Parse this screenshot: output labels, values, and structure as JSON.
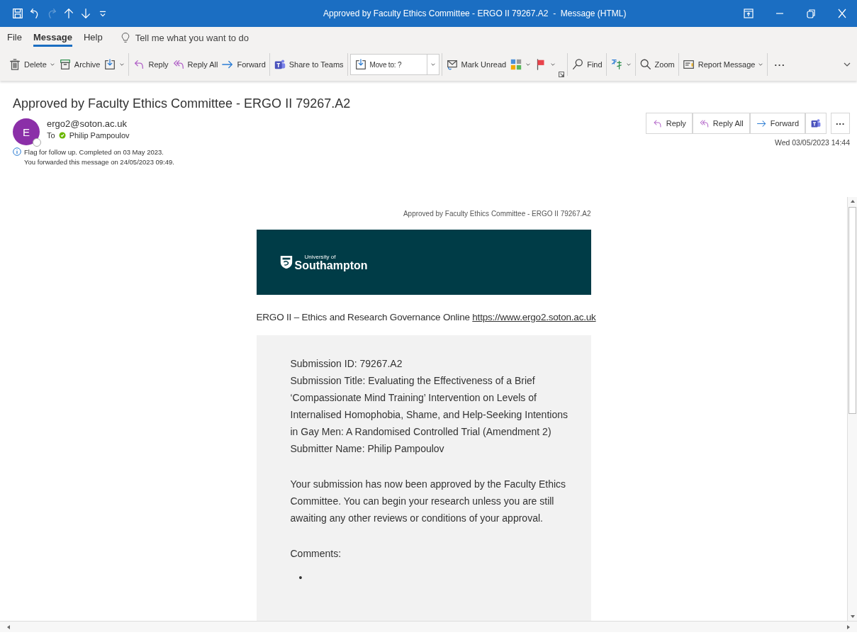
{
  "title_bar": {
    "quick_access": [
      {
        "disabled": false
      },
      {
        "disabled": false
      },
      {
        "disabled": true
      },
      {
        "disabled": false
      },
      {
        "disabled": false
      },
      {
        "disabled": false
      }
    ],
    "title": "Approved by Faculty Ethics Committee - ERGO II 79267.A2  -  Message (HTML)"
  },
  "ribbon_tabs": [
    {
      "label": "File",
      "selected": false
    },
    {
      "label": "Message",
      "selected": true
    },
    {
      "label": "Help",
      "selected": false
    }
  ],
  "tell_me": {
    "placeholder": "Tell me what you want to do"
  },
  "toolbar": [
    {
      "kind": "button",
      "label": "Delete",
      "dropdown": true
    },
    {
      "kind": "button",
      "label": "Archive",
      "dropdown": false
    },
    {
      "kind": "button",
      "dropdown": true
    },
    {
      "kind": "separator"
    },
    {
      "kind": "button",
      "label": "Reply",
      "dropdown": false
    },
    {
      "kind": "button",
      "label": "Reply All",
      "dropdown": false
    },
    {
      "kind": "button",
      "label": "Forward",
      "dropdown": false
    },
    {
      "kind": "separator"
    },
    {
      "kind": "button",
      "label": "Share to Teams",
      "dropdown": false
    },
    {
      "kind": "separator"
    },
    {
      "kind": "combo",
      "value": "Move to: ?"
    },
    {
      "kind": "separator"
    },
    {
      "kind": "button",
      "label": "Mark Unread",
      "dropdown": false
    },
    {
      "kind": "button",
      "dropdown": true
    },
    {
      "kind": "button",
      "dropdown": true
    },
    {
      "kind": "launcher"
    },
    {
      "kind": "separator"
    },
    {
      "kind": "button",
      "label": "Find",
      "dropdown": false
    },
    {
      "kind": "separator"
    },
    {
      "kind": "button",
      "dropdown": true
    },
    {
      "kind": "separator"
    },
    {
      "kind": "button",
      "label": "Zoom",
      "dropdown": false
    },
    {
      "kind": "separator"
    },
    {
      "kind": "button",
      "label": "Report Message",
      "dropdown": true
    },
    {
      "kind": "separator"
    },
    {
      "kind": "more",
      "label": "···"
    }
  ],
  "message": {
    "subject": "Approved by Faculty Ethics Committee - ERGO II 79267.A2",
    "avatar_initial": "E",
    "sender": "ergo2@soton.ac.uk",
    "to_label": "To",
    "recipient": "Philip Pampoulov",
    "info": [
      "Flag for follow up.  Completed on 03 May 2023.",
      "You forwarded this message on 24/05/2023 09:49."
    ],
    "actions": [
      {
        "kind": "reply",
        "label": "Reply"
      },
      {
        "kind": "reply_all",
        "label": "Reply All"
      },
      {
        "kind": "forward",
        "label": "Forward"
      },
      {
        "kind": "teams"
      },
      {
        "kind": "more",
        "label": "···"
      }
    ],
    "date": "Wed 03/05/2023 14:44"
  },
  "body": {
    "header_line": "Approved by Faculty Ethics Committee - ERGO II 79267.A2",
    "logo": {
      "line_1": "University of",
      "line_2": "Southampton"
    },
    "intro": "ERGO II – Ethics and Research Governance Online",
    "intro_link": "https://www.ergo2.soton.ac.uk",
    "details": [
      "Submission ID: 79267.A2",
      "Submission Title: Evaluating the Effectiveness of a Brief ‘Compassionate Mind Training’ Intervention on Levels of Internalised Homophobia, Shame, and Help-Seeking Intentions in Gay Men: A Randomised Controlled Trial (Amendment 2)",
      "Submitter Name: Philip Pampoulov"
    ],
    "approval": "Your submission has now been approved by the Faculty Ethics Committee. You can begin your research unless you are still awaiting any other reviews or conditions of your approval.",
    "comments_label": "Comments:",
    "comment_bullets": [
      "•"
    ]
  }
}
